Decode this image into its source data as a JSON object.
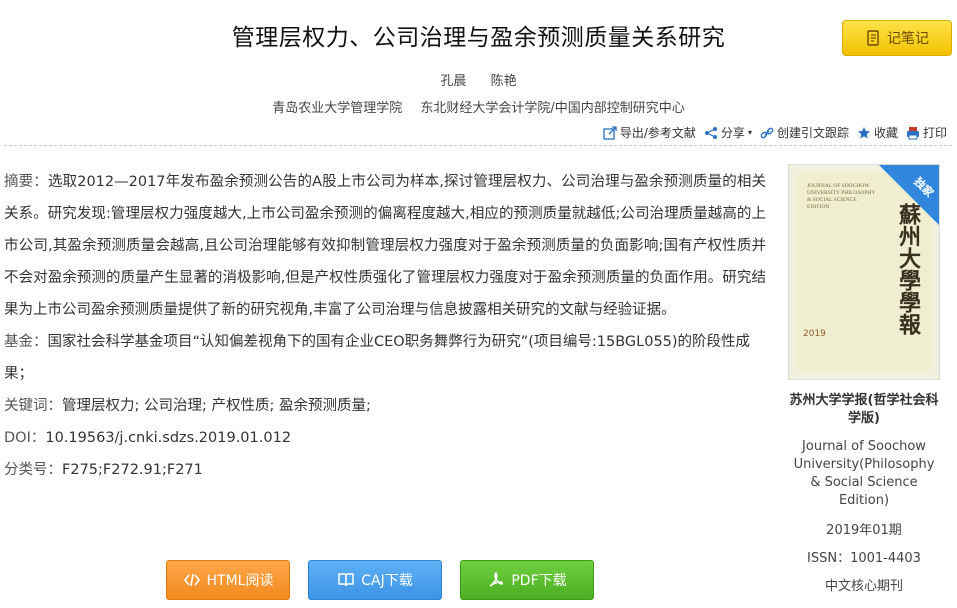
{
  "title": "管理层权力、公司治理与盈余预测质量关系研究",
  "note_button": "记笔记",
  "authors": [
    "孔晨",
    "陈艳"
  ],
  "organizations": [
    "青岛农业大学管理学院",
    "东北财经大学会计学院/中国内部控制研究中心"
  ],
  "toolbar": {
    "export": "导出/参考文献",
    "share": "分享",
    "cite": "创建引文跟踪",
    "favorite": "收藏",
    "print": "打印"
  },
  "abstract": {
    "label": "摘要：",
    "text": "选取2012—2017年发布盈余预测公告的A股上市公司为样本,探讨管理层权力、公司治理与盈余预测质量的相关关系。研究发现:管理层权力强度越大,上市公司盈余预测的偏离程度越大,相应的预测质量就越低;公司治理质量越高的上市公司,其盈余预测质量会越高,且公司治理能够有效抑制管理层权力强度对于盈余预测质量的负面影响;国有产权性质并不会对盈余预测的质量产生显著的消极影响,但是产权性质强化了管理层权力强度对于盈余预测质量的负面作用。研究结果为上市公司盈余预测质量提供了新的研究视角,丰富了公司治理与信息披露相关研究的文献与经验证据。"
  },
  "fund": {
    "label": "基金：",
    "text": "国家社会科学基金项目“认知偏差视角下的国有企业CEO职务舞弊行为研究”(项目编号:15BGL055)的阶段性成果；"
  },
  "keywords": {
    "label": "关键词：",
    "text": "管理层权力; 公司治理; 产权性质; 盈余预测质量;"
  },
  "doi": {
    "label": "DOI：",
    "text": "10.19563/j.cnki.sdzs.2019.01.012"
  },
  "classification": {
    "label": "分类号：",
    "text": "F275;F272.91;F271"
  },
  "journal": {
    "badge": "独家",
    "name": "苏州大学学报(哲学社会科学版)",
    "english_name": "Journal of Soochow University(Philosophy & Social Science Edition)",
    "issue": "2019年01期",
    "issn": "ISSN：1001-4403",
    "core": "中文核心期刊",
    "cover": {
      "en_title": "JOURNAL OF SOOCHOW UNIVERSITY PHILOSOPHY & SOCIAL SCIENCE EDITION",
      "cn_title": "蘇州大學學報",
      "year": "2019"
    }
  },
  "buttons": {
    "html": "HTML阅读",
    "caj": "CAJ下载",
    "pdf": "PDF下载"
  },
  "colors": {
    "note": "#f2c200",
    "html": "#f28a1e",
    "caj": "#3d93e6",
    "pdf": "#4cae22",
    "badge": "#2f86dc"
  }
}
